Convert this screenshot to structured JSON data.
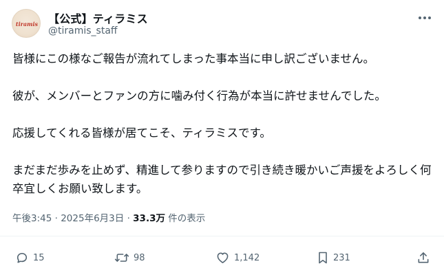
{
  "author": {
    "display_name": "【公式】ティラミス",
    "handle": "@tiramis_staff",
    "avatar_logo_text": "tiramis"
  },
  "tweet": {
    "paragraphs": [
      "皆様にこの様なご報告が流れてしまった事本当に申し訳ございません。",
      "彼が、メンバーとファンの方に噛み付く行為が本当に許せませんでした。",
      "応援してくれる皆様が居てこそ、ティラミスです。",
      "まだまだ歩みを止めず、精進して参りますので引き続き暖かいご声援をよろしく何卒宜しくお願い致します。"
    ]
  },
  "meta": {
    "time": "午後3:45",
    "separator": "·",
    "date": "2025年6月3日",
    "views_count": "33.3万",
    "views_label": "件の表示"
  },
  "actions": {
    "reply_count": "15",
    "repost_count": "98",
    "like_count": "1,142",
    "bookmark_count": "231"
  },
  "icons": {
    "more": "more-horizontal-icon",
    "reply": "reply-icon",
    "repost": "repost-icon",
    "like": "heart-icon",
    "bookmark": "bookmark-icon",
    "share": "share-icon"
  },
  "colors": {
    "text_primary": "#0f1419",
    "text_secondary": "#536471",
    "divider": "#eff3f4",
    "avatar_bg": "#efe1cf",
    "avatar_logo": "#c0392b"
  }
}
